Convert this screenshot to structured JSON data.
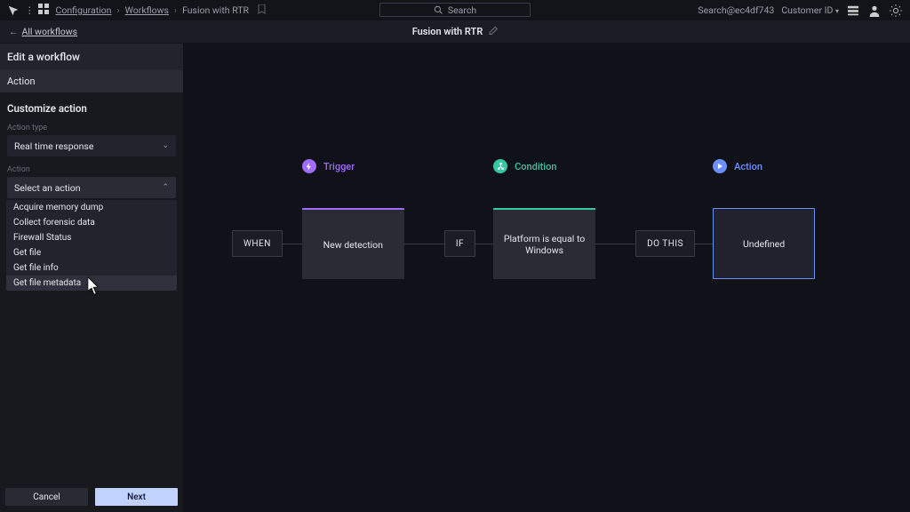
{
  "breadcrumbs": {
    "configuration": "Configuration",
    "workflows": "Workflows",
    "current": "Fusion with RTR"
  },
  "topbar": {
    "search_placeholder": "Search",
    "search_short": "Search@ec4df743",
    "customer_id_label": "Customer ID"
  },
  "subtop": {
    "back": "All workflows",
    "title": "Fusion with RTR"
  },
  "panel": {
    "heading": "Edit a workflow",
    "subheading": "Action",
    "section": "Customize action",
    "action_type_label": "Action type",
    "action_type_value": "Real time response",
    "action_label": "Action",
    "action_value": "Select an action",
    "options": {
      "0": "Acquire memory dump",
      "1": "Collect forensic data",
      "2": "Firewall Status",
      "3": "Get file",
      "4": "Get file info",
      "5": "Get file metadata"
    },
    "cancel": "Cancel",
    "next": "Next"
  },
  "flow": {
    "when": "WHEN",
    "if": "IF",
    "do_this": "DO THIS",
    "trigger_label": "Trigger",
    "condition_label": "Condition",
    "action_label": "Action",
    "trigger_card": "New detection",
    "condition_card": "Platform is equal to Windows",
    "action_card": "Undefined"
  }
}
